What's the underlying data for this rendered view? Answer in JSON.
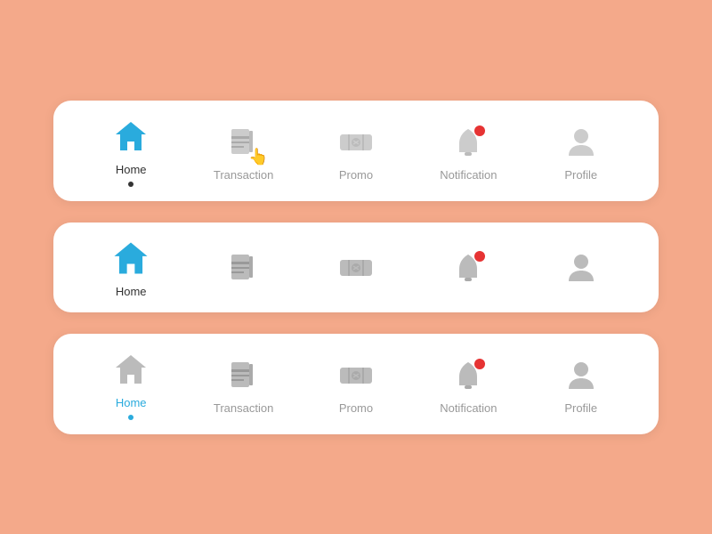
{
  "bars": [
    {
      "id": "bar1",
      "variant": "labeled-with-cursor",
      "items": [
        {
          "key": "home",
          "label": "Home",
          "labelState": "active-dark",
          "showDot": true,
          "dotColor": "dark",
          "iconState": "active"
        },
        {
          "key": "transaction",
          "label": "Transaction",
          "labelState": "gray",
          "showDot": false,
          "iconState": "gray",
          "hasCursor": true
        },
        {
          "key": "promo",
          "label": "Promo",
          "labelState": "gray",
          "showDot": false,
          "iconState": "gray"
        },
        {
          "key": "notification",
          "label": "Notification",
          "labelState": "gray",
          "showDot": false,
          "iconState": "gray",
          "hasBadge": true
        },
        {
          "key": "profile",
          "label": "Profile",
          "labelState": "gray",
          "showDot": false,
          "iconState": "gray"
        }
      ]
    },
    {
      "id": "bar2",
      "variant": "icon-only",
      "items": [
        {
          "key": "home",
          "label": "Home",
          "labelState": "active-dark",
          "showDot": false,
          "iconState": "active"
        },
        {
          "key": "transaction",
          "label": "",
          "labelState": "",
          "showDot": false,
          "iconState": "gray"
        },
        {
          "key": "promo",
          "label": "",
          "labelState": "",
          "showDot": false,
          "iconState": "gray"
        },
        {
          "key": "notification",
          "label": "",
          "labelState": "",
          "showDot": false,
          "iconState": "gray",
          "hasBadge": true
        },
        {
          "key": "profile",
          "label": "",
          "labelState": "",
          "showDot": false,
          "iconState": "gray"
        }
      ]
    },
    {
      "id": "bar3",
      "variant": "labeled-blue-active",
      "items": [
        {
          "key": "home",
          "label": "Home",
          "labelState": "active-blue",
          "showDot": true,
          "dotColor": "blue",
          "iconState": "gray"
        },
        {
          "key": "transaction",
          "label": "Transaction",
          "labelState": "gray",
          "showDot": false,
          "iconState": "gray"
        },
        {
          "key": "promo",
          "label": "Promo",
          "labelState": "gray",
          "showDot": false,
          "iconState": "gray"
        },
        {
          "key": "notification",
          "label": "Notification",
          "labelState": "gray",
          "showDot": false,
          "iconState": "gray",
          "hasBadge": true
        },
        {
          "key": "profile",
          "label": "Profile",
          "labelState": "gray",
          "showDot": false,
          "iconState": "gray"
        }
      ]
    }
  ],
  "labels": {
    "home": "Home",
    "transaction": "Transaction",
    "promo": "Promo",
    "notification": "Notification",
    "profile": "Profile"
  }
}
